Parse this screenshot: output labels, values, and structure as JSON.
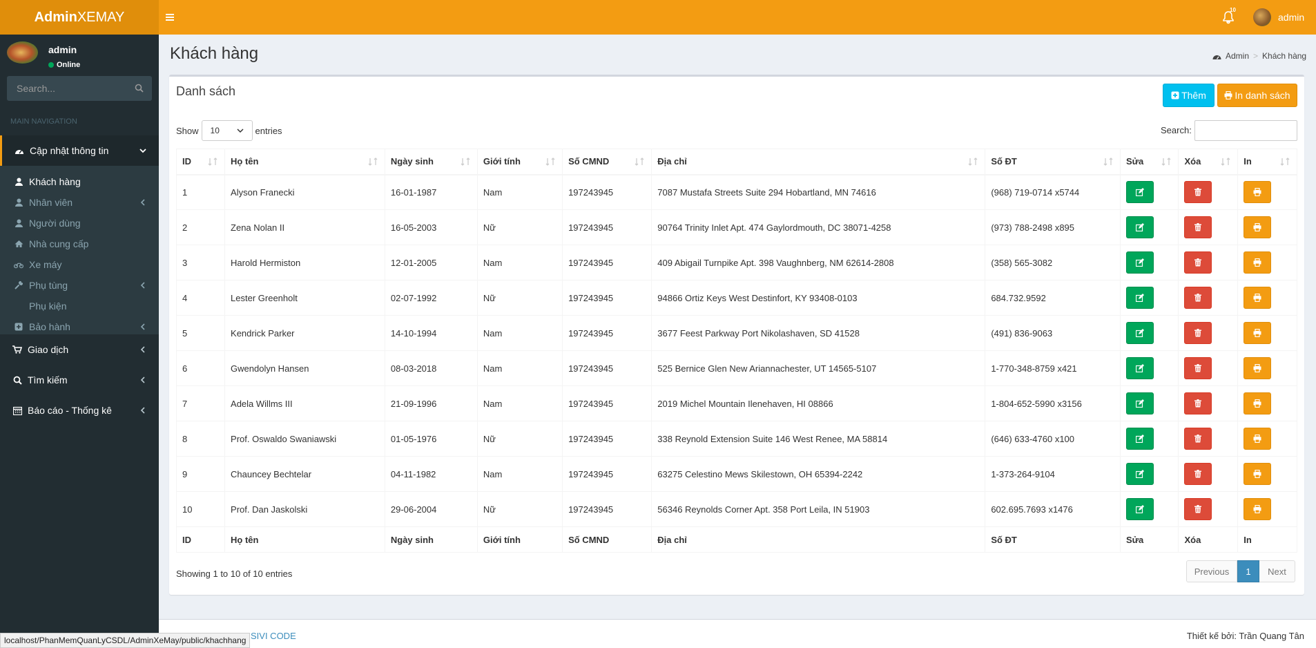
{
  "header": {
    "logo_bold": "Admin",
    "logo_rest": "XEMAY",
    "notif_count": "10",
    "user": "admin"
  },
  "sidebar": {
    "user_name": "admin",
    "status": "Online",
    "search_placeholder": "Search...",
    "nav_heading": "MAIN NAVIGATION",
    "open_menu": "Cập nhật thông tin",
    "sub_items": [
      {
        "label": "Khách hàng",
        "icon": "user-icon"
      },
      {
        "label": "Nhân viên",
        "icon": "user-tie-icon"
      },
      {
        "label": "Người dùng",
        "icon": "user-icon"
      },
      {
        "label": "Nhà cung cấp",
        "icon": "home-icon"
      },
      {
        "label": "Xe máy",
        "icon": "motorcycle-icon"
      },
      {
        "label": "Phụ tùng",
        "icon": "wrench-icon"
      },
      {
        "label": "Phụ kiện",
        "icon": ""
      },
      {
        "label": "Bảo hành",
        "icon": "plus-square-icon"
      }
    ],
    "menu": [
      {
        "label": "Giao dịch",
        "icon": "cart-icon"
      },
      {
        "label": "Tìm kiếm",
        "icon": "search-icon"
      },
      {
        "label": "Báo cáo - Thống kê",
        "icon": "calendar-icon"
      }
    ]
  },
  "page": {
    "title": "Khách hàng",
    "breadcrumb": [
      "Admin",
      "Khách hàng"
    ]
  },
  "box": {
    "title": "Danh sách",
    "add_label": "Thêm",
    "print_label": "In danh sách",
    "show_label": "Show",
    "entries_label": "entries",
    "page_size": "10",
    "search_label": "Search:",
    "info": "Showing 1 to 10 of 10 entries",
    "prev": "Previous",
    "current_page": "1",
    "next": "Next"
  },
  "table": {
    "columns": [
      "ID",
      "Họ tên",
      "Ngày sinh",
      "Giới tính",
      "Số CMND",
      "Địa chỉ",
      "Số ĐT",
      "Sửa",
      "Xóa",
      "In"
    ],
    "rows": [
      [
        "1",
        "Alyson Franecki",
        "16-01-1987",
        "Nam",
        "197243945",
        "7087 Mustafa Streets Suite 294 Hobartland, MN 74616",
        "(968) 719-0714 x5744"
      ],
      [
        "2",
        "Zena Nolan II",
        "16-05-2003",
        "Nữ",
        "197243945",
        "90764 Trinity Inlet Apt. 474 Gaylordmouth, DC 38071-4258",
        "(973) 788-2498 x895"
      ],
      [
        "3",
        "Harold Hermiston",
        "12-01-2005",
        "Nam",
        "197243945",
        "409 Abigail Turnpike Apt. 398 Vaughnberg, NM 62614-2808",
        "(358) 565-3082"
      ],
      [
        "4",
        "Lester Greenholt",
        "02-07-1992",
        "Nữ",
        "197243945",
        "94866 Ortiz Keys West Destinfort, KY 93408-0103",
        "684.732.9592"
      ],
      [
        "5",
        "Kendrick Parker",
        "14-10-1994",
        "Nam",
        "197243945",
        "3677 Feest Parkway Port Nikolashaven, SD 41528",
        "(491) 836-9063"
      ],
      [
        "6",
        "Gwendolyn Hansen",
        "08-03-2018",
        "Nam",
        "197243945",
        "525 Bernice Glen New Ariannachester, UT 14565-5107",
        "1-770-348-8759 x421"
      ],
      [
        "7",
        "Adela Willms III",
        "21-09-1996",
        "Nam",
        "197243945",
        "2019 Michel Mountain Ilenehaven, HI 08866",
        "1-804-652-5990 x3156"
      ],
      [
        "8",
        "Prof. Oswaldo Swaniawski",
        "01-05-1976",
        "Nữ",
        "197243945",
        "338 Reynold Extension Suite 146 West Renee, MA 58814",
        "(646) 633-4760 x100"
      ],
      [
        "9",
        "Chauncey Bechtelar",
        "04-11-1982",
        "Nam",
        "197243945",
        "63275 Celestino Mews Skilestown, OH 65394-2242",
        "1-373-264-9104"
      ],
      [
        "10",
        "Prof. Dan Jaskolski",
        "29-06-2004",
        "Nữ",
        "197243945",
        "56346 Reynolds Corner Apt. 358 Port Leila, IN 51903",
        "602.695.7693 x1476"
      ]
    ]
  },
  "footer": {
    "link": "SIVI CODE",
    "credit": "Thiết kế bởi: Trần Quang Tân"
  },
  "statusbar": "localhost/PhanMemQuanLyCSDL/AdminXeMay/public/khachhang",
  "colors": {
    "header": "#f39c12",
    "sidebar": "#222d32",
    "edit": "#00a65a",
    "delete": "#dd4b39",
    "print": "#f39c12",
    "add": "#00c0ef"
  }
}
